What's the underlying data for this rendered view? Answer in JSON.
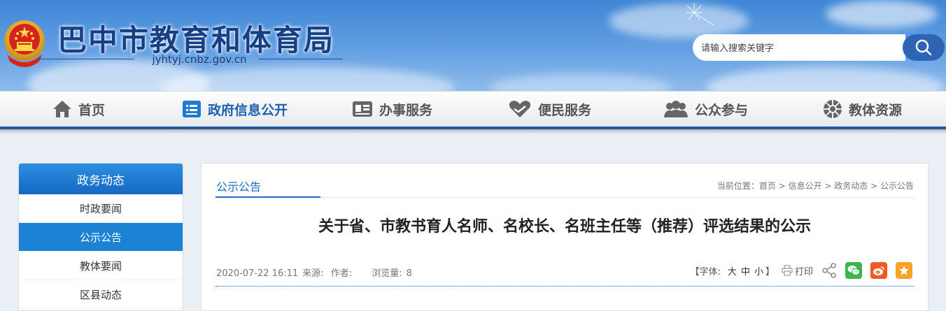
{
  "header": {
    "site_title": "巴中市教育和体育局",
    "domain": "jyhtyj.cnbz.gov.cn",
    "search_placeholder": "请输入搜索关键字"
  },
  "nav": {
    "items": [
      {
        "label": "首页",
        "icon": "home-icon"
      },
      {
        "label": "政府信息公开",
        "icon": "gov-info-icon"
      },
      {
        "label": "办事服务",
        "icon": "services-icon"
      },
      {
        "label": "便民服务",
        "icon": "heart-hand-icon"
      },
      {
        "label": "公众参与",
        "icon": "people-icon"
      },
      {
        "label": "教体资源",
        "icon": "sports-ball-icon"
      }
    ],
    "active_index": 1
  },
  "sidebar": {
    "title": "政务动态",
    "items": [
      {
        "label": "时政要闻"
      },
      {
        "label": "公示公告"
      },
      {
        "label": "教体要闻"
      },
      {
        "label": "区县动态"
      }
    ],
    "active_index": 1
  },
  "main": {
    "tab": "公示公告",
    "breadcrumb": {
      "prefix": "当前位置：",
      "items": [
        "首页",
        "信息公开",
        "政务动态",
        "公示公告"
      ],
      "separator": " > "
    },
    "article": {
      "title": "关于省、市教书育人名师、名校长、名班主任等（推荐）评选结果的公示",
      "date": "2020-07-22 16:11",
      "source_label": "来源:",
      "author_label": "作者:",
      "views_label": "浏览量:",
      "views": "8"
    },
    "tools": {
      "font_label": "【字体:",
      "size_large": "大",
      "size_medium": "中",
      "size_small": "小",
      "font_close": "】",
      "print": "打印"
    }
  },
  "colors": {
    "brand_blue": "#1e6bc4",
    "nav_active": "#1f5fb0",
    "sidebar_active": "#1c82d4",
    "wechat": "#3bb64a",
    "weibo": "#f05a24",
    "favorite": "#f7a428"
  }
}
